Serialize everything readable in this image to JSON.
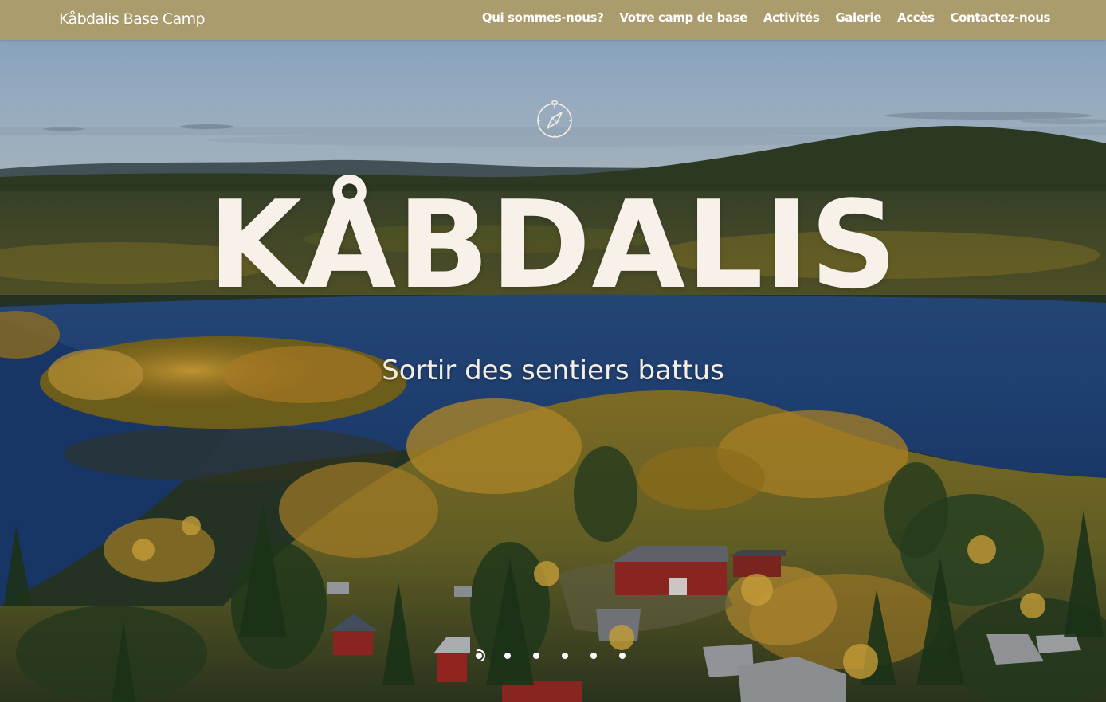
{
  "header": {
    "site_title": "Kåbdalis Base Camp",
    "background_color": "#ab9c6d",
    "nav": [
      {
        "label": "Qui sommes-nous?"
      },
      {
        "label": "Votre camp de base"
      },
      {
        "label": "Activités"
      },
      {
        "label": "Galerie"
      },
      {
        "label": "Accès"
      },
      {
        "label": "Contactez-nous"
      }
    ]
  },
  "hero": {
    "icon": "compass-icon",
    "title": "KÅBDALIS",
    "subtitle": "Sortir des sentiers battus",
    "title_color": "#f7f1ea",
    "slides_count": 6,
    "active_slide": 1
  }
}
